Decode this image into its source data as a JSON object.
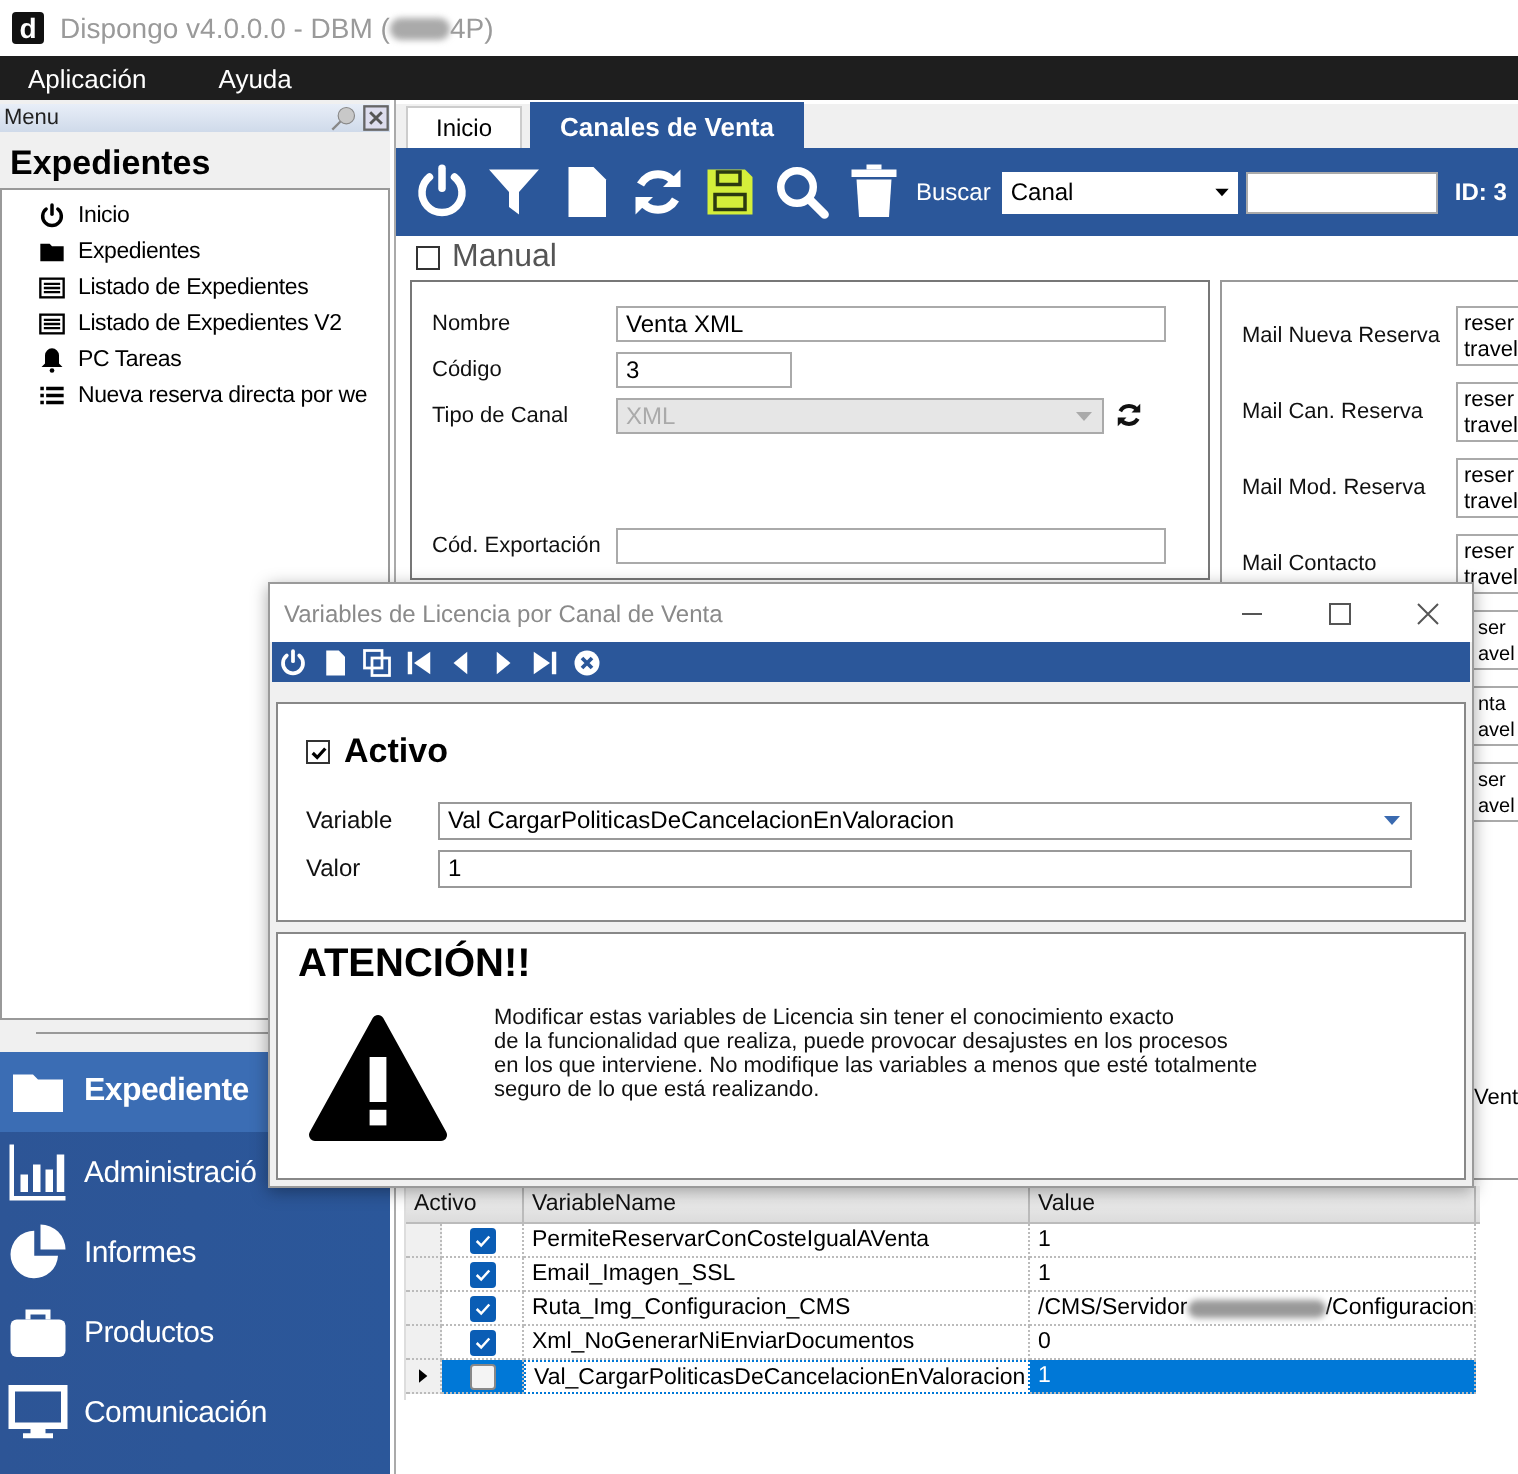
{
  "window": {
    "logo": "d",
    "title": "Dispongo v4.0.0.0 - DBM (",
    "title_end": "4P)"
  },
  "menu_bar": [
    "Aplicación",
    "Ayuda"
  ],
  "sidebar": {
    "header": "Menu",
    "title": "Expedientes",
    "tree": [
      {
        "label": "Inicio"
      },
      {
        "label": "Expedientes"
      },
      {
        "label": "Listado de Expedientes"
      },
      {
        "label": "Listado de Expedientes V2"
      },
      {
        "label": "PC Tareas"
      },
      {
        "label": "Nueva reserva directa por we"
      }
    ],
    "nav": [
      {
        "label": "Expediente",
        "selected": true
      },
      {
        "label": "Administració",
        "selected": false
      },
      {
        "label": "Informes",
        "selected": false
      },
      {
        "label": "Productos",
        "selected": false
      },
      {
        "label": "Comunicación",
        "selected": false
      }
    ]
  },
  "tabs": [
    {
      "label": "Inicio",
      "selected": false
    },
    {
      "label": "Canales de Venta",
      "selected": true
    }
  ],
  "toolbar": {
    "search_label": "Buscar",
    "search_by": "Canal",
    "id_label": "ID: 3"
  },
  "manual": {
    "label": "Manual",
    "checked": false
  },
  "form": {
    "fields": [
      {
        "label": "Nombre",
        "value": "Venta XML",
        "kind": "text"
      },
      {
        "label": "Código",
        "value": "3",
        "kind": "short"
      },
      {
        "label": "Tipo de Canal",
        "value": "XML",
        "kind": "select",
        "disabled": true
      },
      {
        "label": "Cód. Exportación",
        "kind": "text"
      }
    ]
  },
  "mail_fields": [
    {
      "label": "Mail Nueva Reserva",
      "lines": [
        "reser",
        "travel"
      ]
    },
    {
      "label": "Mail Can. Reserva",
      "lines": [
        "reser",
        "travel"
      ]
    },
    {
      "label": "Mail Mod. Reserva",
      "lines": [
        "reser",
        "travel"
      ]
    },
    {
      "label": "Mail Contacto",
      "lines": [
        "reser",
        "travel"
      ]
    },
    {
      "lines": [
        "ser",
        "avel"
      ]
    },
    {
      "lines": [
        "nta",
        "avel"
      ]
    },
    {
      "lines": [
        "ser",
        "avel"
      ]
    }
  ],
  "right_partial": "Vent",
  "grid": {
    "columns": [
      "Activo",
      "VariableName",
      "Value"
    ],
    "rows": [
      {
        "active": true,
        "name": "PermiteReservarConCosteIgualAVenta",
        "value": "1",
        "selected": false
      },
      {
        "active": true,
        "name": "Email_Imagen_SSL",
        "value": "1",
        "selected": false
      },
      {
        "active": true,
        "name": "Ruta_Img_Configuracion_CMS",
        "value": "/CMS/Servidor",
        "value_tail": "/Configuracion",
        "selected": false
      },
      {
        "active": true,
        "name": "Xml_NoGenerarNiEnviarDocumentos",
        "value": "0",
        "selected": false
      },
      {
        "active": false,
        "name": "Val_CargarPoliticasDeCancelacionEnValoracion",
        "value": "1",
        "selected": true
      }
    ]
  },
  "dialog": {
    "title": "Variables de Licencia por Canal de Venta",
    "activo": {
      "label": "Activo",
      "checked": true
    },
    "variable_label": "Variable",
    "variable_value": "Val CargarPoliticasDeCancelacionEnValoracion",
    "valor_label": "Valor",
    "valor_value": "1",
    "warning_title": "ATENCIÓN!!",
    "warning_text": "Modificar estas variables de Licencia sin tener el conocimiento exacto\nde la funcionalidad que realiza, puede provocar desajustes en los procesos\nen los que interviene. No modifique las variables a menos que esté totalmente\nseguro de lo que está realizando."
  }
}
